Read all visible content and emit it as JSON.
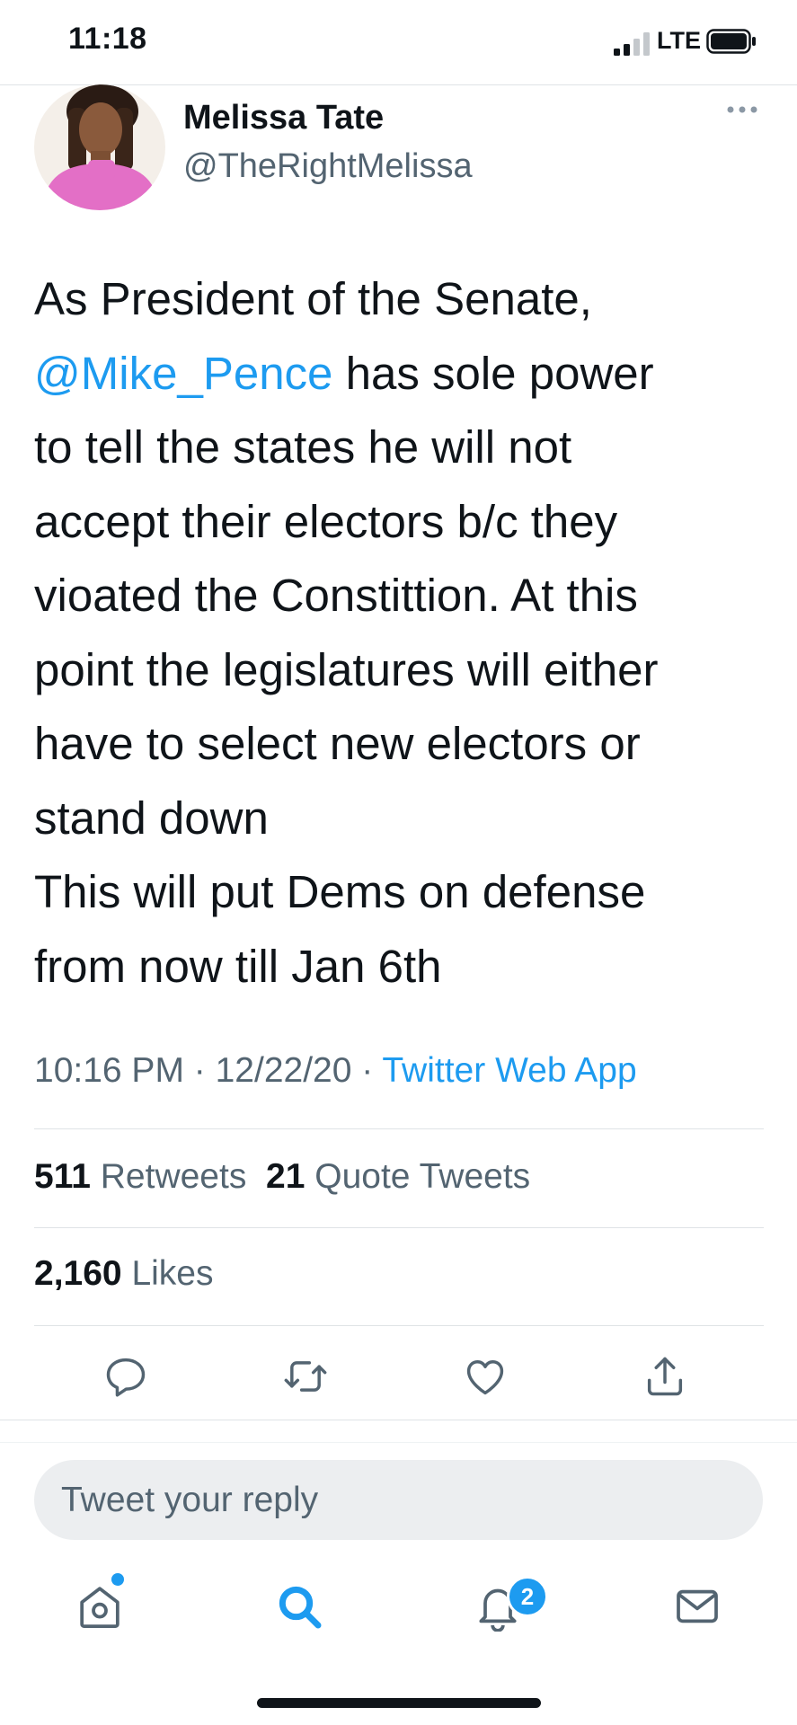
{
  "status_bar": {
    "time": "11:18",
    "network": "LTE"
  },
  "tweet": {
    "author_name": "Melissa Tate",
    "author_handle": "@TheRightMelissa",
    "body_lines": [
      {
        "text": "As President of the Senate,"
      },
      {
        "mention": "@Mike_Pence",
        "text": " has sole power"
      },
      {
        "text": "to tell the states he will not"
      },
      {
        "text": "accept their electors b/c they"
      },
      {
        "text": "vioated the Constittion. At this"
      },
      {
        "text": "point the legislatures will either"
      },
      {
        "text": "have to select new electors or"
      },
      {
        "text": "stand down"
      },
      {
        "text": "This will put Dems on defense"
      },
      {
        "text": "from now till Jan 6th"
      }
    ],
    "time": "10:16 PM",
    "separator": " · ",
    "date": "12/22/20",
    "source": "Twitter Web App"
  },
  "stats": {
    "retweets_count": "511",
    "retweets_label": "Retweets",
    "quotes_count": "21",
    "quotes_label": "Quote Tweets",
    "likes_count": "2,160",
    "likes_label": "Likes"
  },
  "actions": [
    "reply-icon",
    "retweet-icon",
    "like-icon",
    "share-icon"
  ],
  "reply": {
    "placeholder": "Tweet your reply"
  },
  "tab_bar": {
    "notifications_badge": "2",
    "icons": [
      "home-icon",
      "search-icon",
      "notifications-icon",
      "messages-icon"
    ]
  },
  "colors": {
    "accent": "#1d9bf0",
    "text": "#0f1419",
    "secondary": "#536471"
  }
}
